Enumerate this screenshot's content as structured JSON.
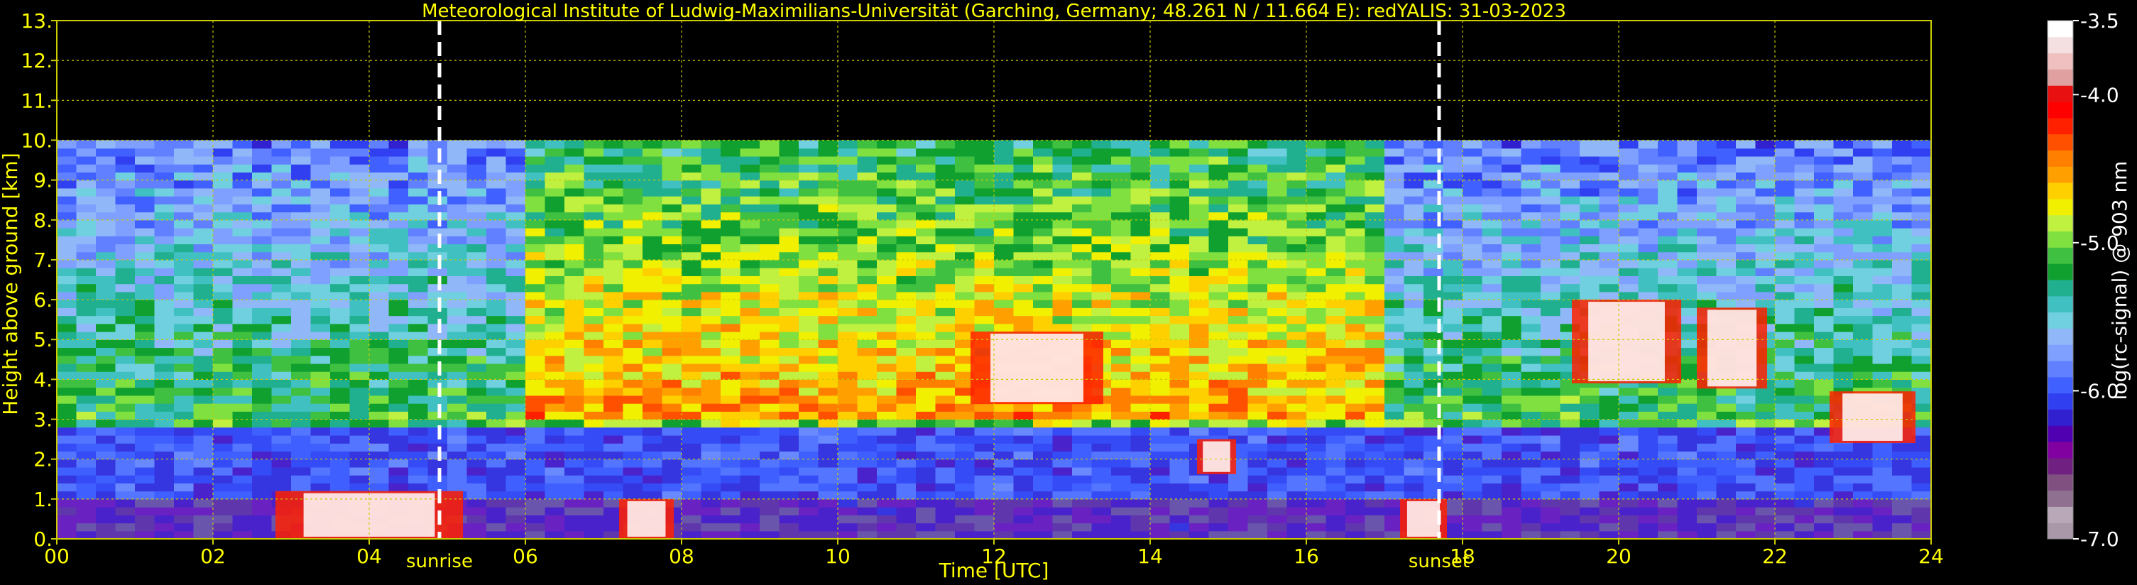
{
  "colors": {
    "background": "#000000",
    "text": "#ffff00",
    "grid": "#cccc00",
    "colorbar_text": "#ffffff",
    "event_line": "#ffffff"
  },
  "chart_data": {
    "type": "heatmap",
    "title": "Meteorological Institute of Ludwig-Maximilians-Universität (Garching, Germany; 48.261 N / 11.664 E):    redYALIS: 31-03-2023",
    "xlabel": "Time [UTC]",
    "ylabel": "Height above ground [km]",
    "xlim": [
      0,
      24
    ],
    "ylim": [
      0,
      13
    ],
    "x_ticks": [
      0,
      2,
      4,
      6,
      8,
      10,
      12,
      14,
      16,
      18,
      20,
      22,
      24
    ],
    "x_tick_labels": [
      "00",
      "02",
      "04",
      "06",
      "08",
      "10",
      "12",
      "14",
      "16",
      "18",
      "20",
      "22",
      "24"
    ],
    "y_ticks": [
      0,
      1,
      2,
      3,
      4,
      5,
      6,
      7,
      8,
      9,
      10,
      11,
      12,
      13
    ],
    "y_tick_labels": [
      "0.",
      "1.",
      "2.",
      "3.",
      "4.",
      "5.",
      "6.",
      "7.",
      "8.",
      "9.",
      "10.",
      "11.",
      "12.",
      "13."
    ],
    "grid": true,
    "data_top_km": 10,
    "events": [
      {
        "label": "sunrise",
        "time": 4.9
      },
      {
        "label": "sunset",
        "time": 17.7
      }
    ],
    "colorbar": {
      "label": "log(rc-signal) @ 903 nm",
      "range": [
        -7.0,
        -3.5
      ],
      "ticks": [
        -3.5,
        -4.0,
        -5.0,
        -6.0,
        -7.0
      ],
      "tick_labels": [
        "-3.5",
        "-4.0",
        "-5.0",
        "-6.0",
        "-7.0"
      ],
      "colors": [
        "#a898a8",
        "#b8a8b8",
        "#907090",
        "#805080",
        "#702080",
        "#8000a0",
        "#5000b0",
        "#3020d0",
        "#3040f0",
        "#4060ff",
        "#6080ff",
        "#80a0ff",
        "#90b8f8",
        "#70d0e0",
        "#40c0c0",
        "#20b090",
        "#10a030",
        "#40c040",
        "#80e040",
        "#c0f040",
        "#f0f000",
        "#ffd000",
        "#ffa000",
        "#ff8000",
        "#ff5000",
        "#ff2000",
        "#ff0000",
        "#e81010",
        "#e0a0a0",
        "#f0c0c0",
        "#f4e0e0",
        "#ffffff"
      ]
    },
    "features": [
      {
        "name": "boundary-layer aerosol",
        "x_start": 0,
        "x_end": 24,
        "y_top": 2.8
      },
      {
        "name": "low cloud / fog",
        "x_start": 2.8,
        "x_end": 5.2,
        "y_top": 1.2
      },
      {
        "name": "cloud",
        "x_start": 7.2,
        "x_end": 7.9,
        "y_top": 1.0
      },
      {
        "name": "cloud",
        "x_start": 11.7,
        "x_end": 13.4,
        "y_top": 5.2
      },
      {
        "name": "cloud",
        "x_start": 14.6,
        "x_end": 15.1,
        "y_top": 2.5
      },
      {
        "name": "cloud",
        "x_start": 17.2,
        "x_end": 17.8,
        "y_top": 1.0
      },
      {
        "name": "elevated cloud",
        "x_start": 19.4,
        "x_end": 20.8,
        "y_top": 6.0
      },
      {
        "name": "elevated cloud",
        "x_start": 21.0,
        "x_end": 21.9,
        "y_top": 5.8
      },
      {
        "name": "cloud",
        "x_start": 22.7,
        "x_end": 23.8,
        "y_top": 3.7
      }
    ]
  }
}
